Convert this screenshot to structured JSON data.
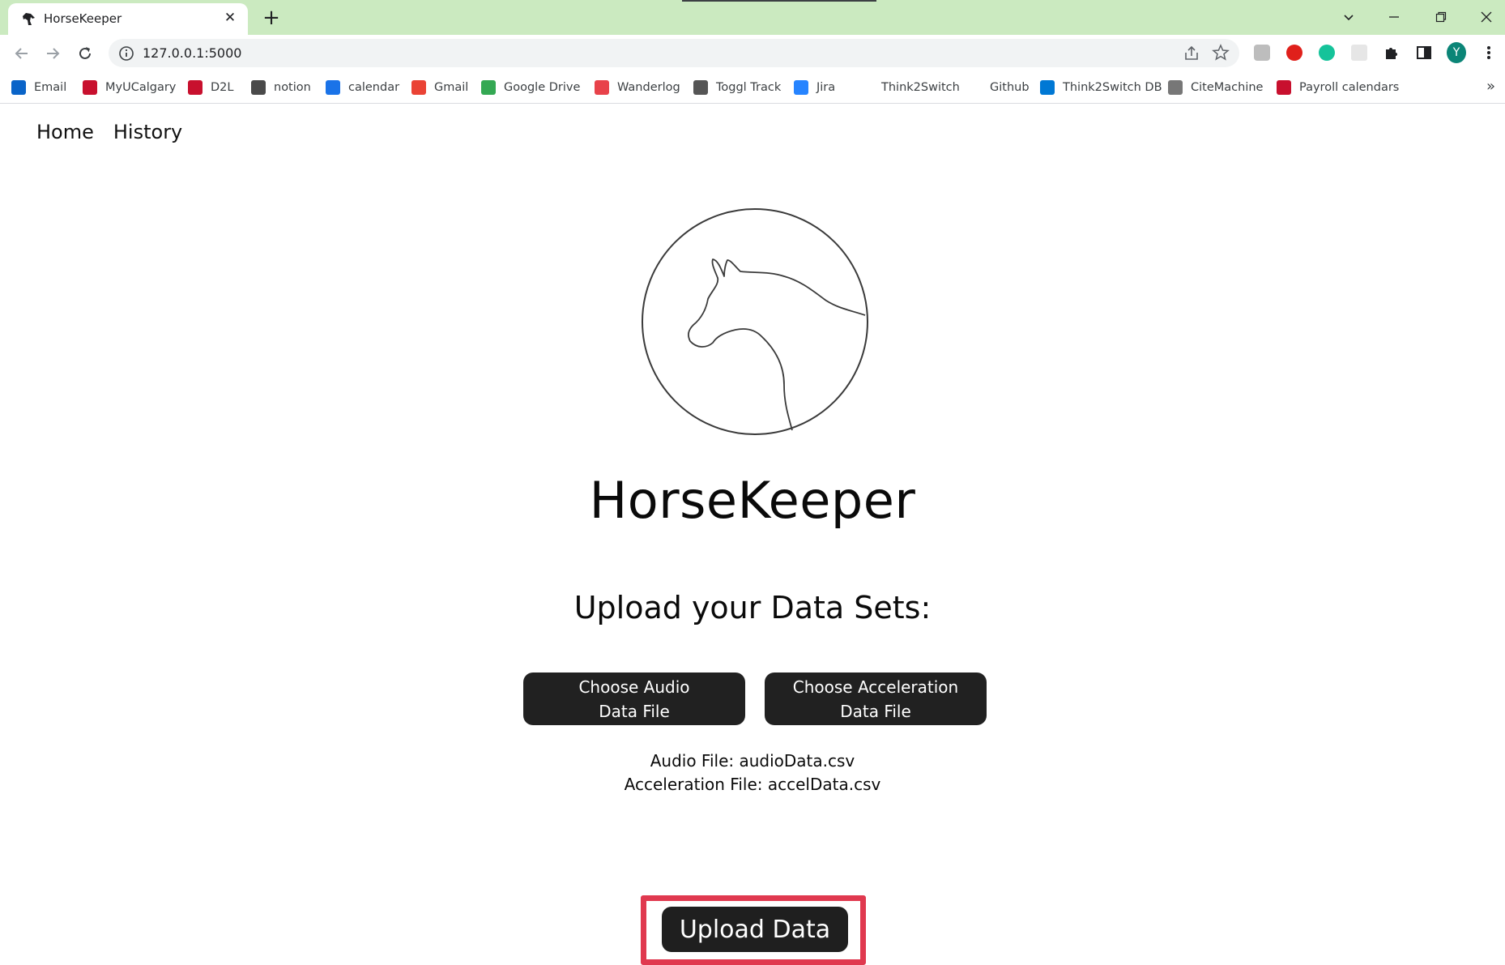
{
  "browser": {
    "tab": {
      "title": "HorseKeeper",
      "favicon": "horse-icon"
    },
    "url": "127.0.0.1:5000",
    "profile_initial": "Y",
    "bookmarks": [
      {
        "label": "Email",
        "icon": "outlook-icon",
        "color": "#0a64c8"
      },
      {
        "label": "MyUCalgary",
        "icon": "ucalgary-crest-icon",
        "color": "#c8102e"
      },
      {
        "label": "D2L",
        "icon": "ucalgary-crest-icon",
        "color": "#c8102e"
      },
      {
        "label": "notion",
        "icon": "notion-icon",
        "color": "#4a4a4a"
      },
      {
        "label": "calendar",
        "icon": "google-calendar-icon",
        "color": "#1a73e8"
      },
      {
        "label": "Gmail",
        "icon": "gmail-icon",
        "color": "#ea4335"
      },
      {
        "label": "Google Drive",
        "icon": "google-drive-icon",
        "color": "#34a853"
      },
      {
        "label": "Wanderlog",
        "icon": "wanderlog-icon",
        "color": "#e8424a"
      },
      {
        "label": "Toggl Track",
        "icon": "toggl-icon",
        "color": "#555555"
      },
      {
        "label": "Jira",
        "icon": "jira-icon",
        "color": "#2684ff"
      },
      {
        "label": "Think2Switch",
        "icon": "",
        "color": ""
      },
      {
        "label": "Github",
        "icon": "",
        "color": ""
      },
      {
        "label": "Think2Switch DB",
        "icon": "azure-icon",
        "color": "#0078d4"
      },
      {
        "label": "CiteMachine",
        "icon": "citemachine-icon",
        "color": "#777777"
      },
      {
        "label": "Payroll calendars",
        "icon": "ucalgary-crest-icon",
        "color": "#c8102e"
      }
    ],
    "bookmarks_more": "»"
  },
  "nav": {
    "home": "Home",
    "history": "History"
  },
  "hero": {
    "title": "HorseKeeper",
    "subtitle": "Upload your Data Sets:"
  },
  "upload": {
    "audio_button_line1": "Choose Audio",
    "audio_button_line2": "Data File",
    "accel_button_line1": "Choose Acceleration",
    "accel_button_line2": "Data File",
    "audio_file_text": "Audio File: audioData.csv",
    "accel_file_text": "Acceleration File: accelData.csv",
    "submit_label": "Upload Data"
  },
  "colors": {
    "tabstrip": "#cbeac0",
    "button": "#212121",
    "highlight": "#e0394f"
  }
}
